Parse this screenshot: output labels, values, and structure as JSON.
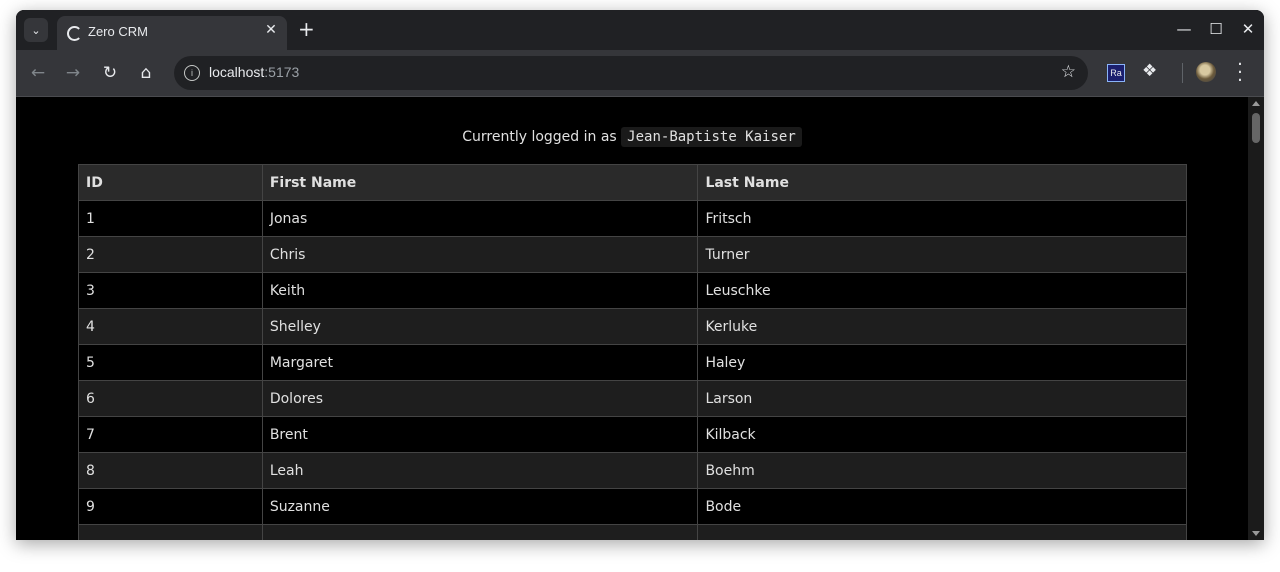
{
  "browser": {
    "tab_title": "Zero CRM",
    "url_host": "localhost",
    "url_port": ":5173",
    "extension_label": "Ra"
  },
  "page": {
    "login_prefix": "Currently logged in as",
    "username": "Jean-Baptiste Kaiser"
  },
  "table": {
    "headers": [
      "ID",
      "First Name",
      "Last Name"
    ],
    "rows": [
      [
        "1",
        "Jonas",
        "Fritsch"
      ],
      [
        "2",
        "Chris",
        "Turner"
      ],
      [
        "3",
        "Keith",
        "Leuschke"
      ],
      [
        "4",
        "Shelley",
        "Kerluke"
      ],
      [
        "5",
        "Margaret",
        "Haley"
      ],
      [
        "6",
        "Dolores",
        "Larson"
      ],
      [
        "7",
        "Brent",
        "Kilback"
      ],
      [
        "8",
        "Leah",
        "Boehm"
      ],
      [
        "9",
        "Suzanne",
        "Bode"
      ],
      [
        "",
        "",
        ""
      ]
    ]
  },
  "icons": {
    "tab_search": "chevron-down-icon",
    "favicon": "loading-icon",
    "close": "close-icon",
    "new_tab": "plus-icon",
    "minimize": "minimize-icon",
    "maximize": "maximize-icon",
    "close_window": "close-icon",
    "back": "arrow-left-icon",
    "forward": "arrow-right-icon",
    "reload": "reload-icon",
    "home": "home-icon",
    "site_info": "info-icon",
    "bookmark": "star-icon",
    "extensions": "puzzle-icon",
    "profile": "avatar",
    "menu": "more-vertical-icon"
  },
  "colors": {
    "page_background": "#000000",
    "header_background": "#2a2a2a",
    "alt_row_background": "#1e1e1e",
    "border": "#444444"
  }
}
